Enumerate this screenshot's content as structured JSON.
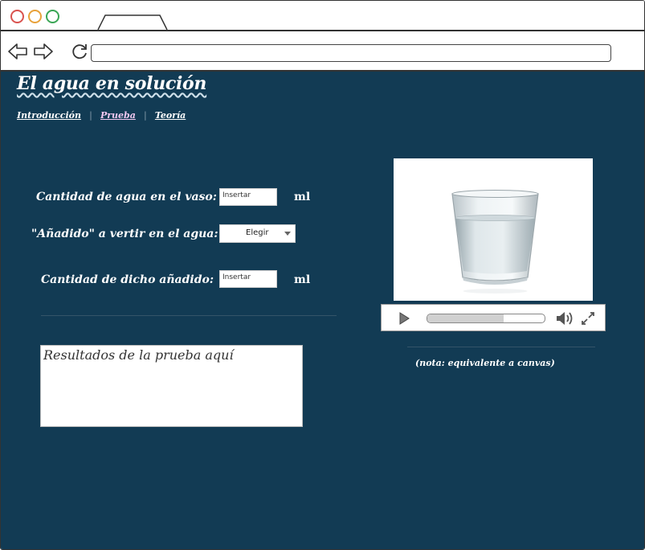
{
  "browser": {
    "url": ""
  },
  "page": {
    "title": "El agua en solución",
    "nav": {
      "items": [
        {
          "label": "Introducción",
          "active": false
        },
        {
          "label": "Prueba",
          "active": true
        },
        {
          "label": "Teoría",
          "active": false
        }
      ]
    },
    "form": {
      "water_label": "Cantidad de agua en el vaso:",
      "water_placeholder": "Insertar",
      "water_unit": "ml",
      "additive_label": "\"Añadido\" a vertir en el agua:",
      "additive_select": "Elegir",
      "amount_label": "Cantidad de dicho añadido:",
      "amount_placeholder": "Insertar",
      "amount_unit": "ml"
    },
    "results_placeholder": "Resultados de la prueba aquí",
    "media": {
      "progress": 0.65,
      "note": "(nota: equivalente a canvas)"
    }
  },
  "colors": {
    "page_bg": "#123b54",
    "active_nav": "#f0c8f0"
  }
}
